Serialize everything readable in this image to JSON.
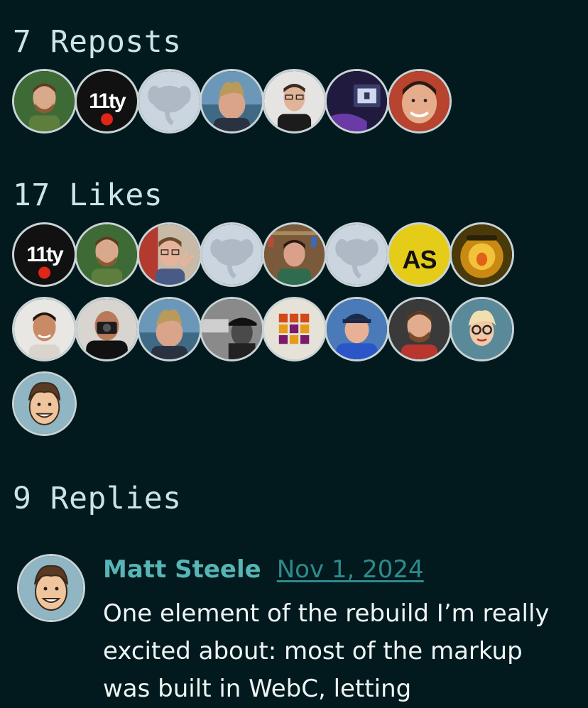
{
  "reposts": {
    "title": "7 Reposts",
    "avatars": [
      {
        "name": "avatar-green-man",
        "bg": "#3e6b35"
      },
      {
        "name": "avatar-11ty",
        "text": "11ty"
      },
      {
        "name": "avatar-mastodon-default"
      },
      {
        "name": "avatar-sand-hair-man"
      },
      {
        "name": "avatar-glasses-man"
      },
      {
        "name": "avatar-computer-purple"
      },
      {
        "name": "avatar-smiling-man"
      }
    ]
  },
  "likes": {
    "title": "17 Likes",
    "avatars": [
      {
        "name": "avatar-11ty",
        "text": "11ty"
      },
      {
        "name": "avatar-green-man"
      },
      {
        "name": "avatar-glasses-peace"
      },
      {
        "name": "avatar-mastodon-default"
      },
      {
        "name": "avatar-shelf-man"
      },
      {
        "name": "avatar-mastodon-default"
      },
      {
        "name": "avatar-as-logo",
        "text": "AS",
        "bg": "#e4cc18"
      },
      {
        "name": "avatar-yellow-glow"
      },
      {
        "name": "avatar-bald-man"
      },
      {
        "name": "avatar-camera-man"
      },
      {
        "name": "avatar-sand-hair-man"
      },
      {
        "name": "avatar-bw-hat-man"
      },
      {
        "name": "avatar-grid-logo"
      },
      {
        "name": "avatar-cap-man"
      },
      {
        "name": "avatar-bearded-man"
      },
      {
        "name": "avatar-cartoon-glasses"
      },
      {
        "name": "avatar-cartoon-man"
      }
    ]
  },
  "replies": {
    "title": "9 Replies",
    "items": [
      {
        "author": "Matt Steele",
        "date": "Nov 1, 2024",
        "text": "One element of the rebuild I’m really excited about: most of the markup was built in WebC, letting"
      }
    ]
  },
  "colors": {
    "background": "#021a1e",
    "heading": "#c9e6e4",
    "author": "#58b5b5",
    "date": "#2e8a8c",
    "avatar_border": "#c8d3d6"
  }
}
